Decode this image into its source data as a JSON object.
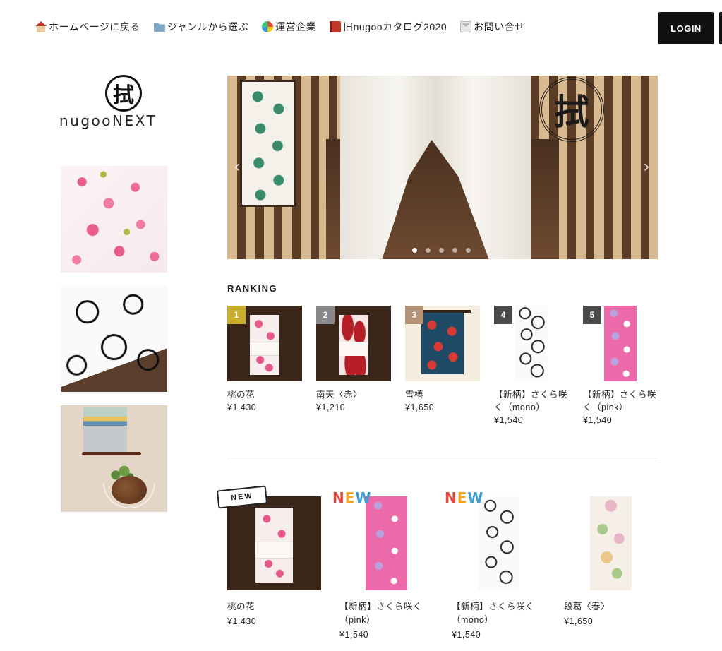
{
  "nav": {
    "items": [
      {
        "icon": "house-icon",
        "label": "ホームページに戻る"
      },
      {
        "icon": "folder-icon",
        "label": "ジャンルから選ぶ"
      },
      {
        "icon": "company-icon",
        "label": "運営企業"
      },
      {
        "icon": "book-icon",
        "label": "旧nugooカタログ2020"
      },
      {
        "icon": "mail-icon",
        "label": "お問い合せ"
      }
    ],
    "login_label": "LOGIN"
  },
  "sidebar": {
    "logo_mark": "拭",
    "logo_text": "nugooNEXT",
    "banners": [
      "plum-pattern-banner",
      "cherry-outline-banner",
      "kokedama-banner"
    ]
  },
  "hero": {
    "crest_char": "拭",
    "slide_count": 5,
    "active_slide": 0
  },
  "ranking": {
    "title": "RANKING",
    "items": [
      {
        "rank": "1",
        "badge_color": "#c9ae2e",
        "name": "桃の花",
        "price": "¥1,430",
        "image": "momo"
      },
      {
        "rank": "2",
        "badge_color": "#888888",
        "name": "南天〈赤〉",
        "price": "¥1,210",
        "image": "nanten"
      },
      {
        "rank": "3",
        "badge_color": "#b49378",
        "name": "雪椿",
        "price": "¥1,650",
        "image": "tsubaki"
      },
      {
        "rank": "4",
        "badge_color": "#4a4a4a",
        "name": "【新柄】さくら咲く（mono）",
        "price": "¥1,540",
        "image": "mono"
      },
      {
        "rank": "5",
        "badge_color": "#4a4a4a",
        "name": "【新柄】さくら咲く（pink）",
        "price": "¥1,540",
        "image": "pink"
      }
    ]
  },
  "new_products": {
    "items": [
      {
        "badge": "NEW",
        "badge_style": "ribbon",
        "name": "桃の花",
        "price": "¥1,430",
        "image": "momo"
      },
      {
        "badge": "NEW",
        "badge_style": "color",
        "name": "【新柄】さくら咲く（pink）",
        "price": "¥1,540",
        "image": "pink"
      },
      {
        "badge": "NEW",
        "badge_style": "color",
        "name": "【新柄】さくら咲く（mono）",
        "price": "¥1,540",
        "image": "mono"
      },
      {
        "badge": "",
        "badge_style": "none",
        "name": "段葛〈春〉",
        "price": "¥1,650",
        "image": "dankatsura"
      }
    ]
  },
  "colors": {
    "login_bg": "#111111",
    "text": "#222222"
  }
}
